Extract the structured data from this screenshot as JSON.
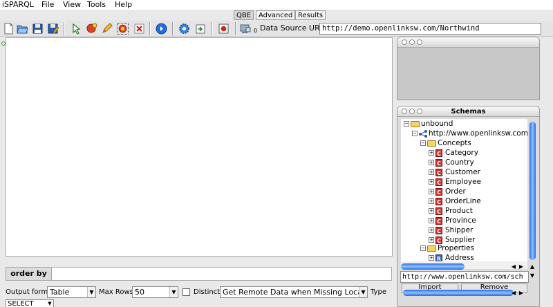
{
  "menu": {
    "app_name": "iSPARQL",
    "file": "File",
    "view": "View",
    "tools": "Tools",
    "help": "Help"
  },
  "tabs": {
    "qbe": "QBE",
    "advanced": "Advanced",
    "results": "Results"
  },
  "toolbar": {
    "counter": "0",
    "data_source_label": "Data Source URI",
    "data_source_value": "http://demo.openlinksw.com/Northwind"
  },
  "orderby": {
    "label": "order by"
  },
  "options": {
    "output_format_label": "Output format",
    "output_format_value": "Table",
    "max_rows_label": "Max Rows",
    "max_rows_value": "50",
    "distinct_label": "Distinct",
    "remote_data_value": "Get Remote Data when Missing Locally",
    "type_label": "Type",
    "type_value": "SELECT"
  },
  "schemas": {
    "title": "Schemas",
    "root": "unbound",
    "graph": "http://www.openlinksw.com",
    "concepts_label": "Concepts",
    "concept_badge": "C",
    "concepts": [
      "Category",
      "Country",
      "Customer",
      "Employee",
      "Order",
      "OrderLine",
      "Product",
      "Province",
      "Shipper",
      "Supplier"
    ],
    "properties_label": "Properties",
    "property_badge": "R",
    "properties": [
      "Address"
    ],
    "uri_value": "http://www.openlinksw.com/sch",
    "import_label": "Import",
    "remove_label": "Remove"
  },
  "colors": {
    "scroll_accent": "#2a6ae0",
    "concept_badge": "#c83232",
    "property_badge": "#3c5aa8"
  }
}
